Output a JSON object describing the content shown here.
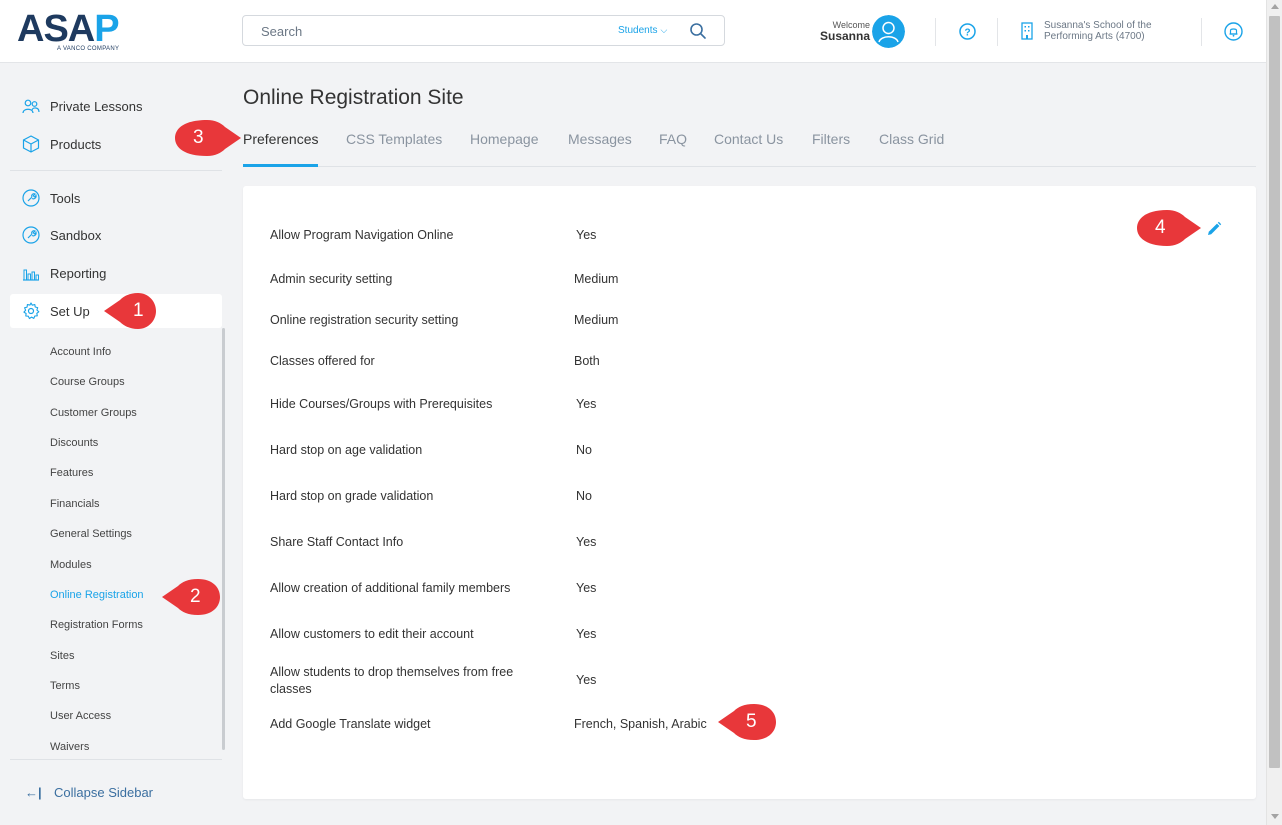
{
  "header": {
    "logo_text_main": "ASA",
    "logo_text_accent": "P",
    "logo_tagline": "A VANCO COMPANY",
    "search_placeholder": "Search",
    "search_scope": "Students",
    "welcome_label": "Welcome",
    "user_name": "Susanna",
    "school_name": "Susanna's School of the Performing Arts (4700)"
  },
  "sidebar": {
    "main_items": [
      {
        "label": "Private Lessons",
        "icon": "people-icon"
      },
      {
        "label": "Products",
        "icon": "box-icon"
      },
      {
        "label": "Tools",
        "icon": "wrench-icon"
      },
      {
        "label": "Sandbox",
        "icon": "wrench-icon"
      },
      {
        "label": "Reporting",
        "icon": "bar-chart-icon"
      },
      {
        "label": "Set Up",
        "icon": "gear-icon"
      }
    ],
    "active_item": "Set Up",
    "sub_items": [
      "Account Info",
      "Course Groups",
      "Customer Groups",
      "Discounts",
      "Features",
      "Financials",
      "General Settings",
      "Modules",
      "Online Registration",
      "Registration Forms",
      "Sites",
      "Terms",
      "User Access",
      "Waivers"
    ],
    "active_sub_item": "Online Registration",
    "collapse_label": "Collapse Sidebar"
  },
  "main": {
    "title": "Online Registration Site",
    "tabs": [
      "Preferences",
      "CSS Templates",
      "Homepage",
      "Messages",
      "FAQ",
      "Contact Us",
      "Filters",
      "Class Grid"
    ],
    "active_tab": "Preferences",
    "preferences": [
      {
        "label": "Allow Program Navigation Online",
        "value": "Yes"
      },
      {
        "label": "Admin security setting",
        "value": "Medium"
      },
      {
        "label": "Online registration security setting",
        "value": "Medium"
      },
      {
        "label": "Classes offered for",
        "value": "Both"
      },
      {
        "label": "Hide Courses/Groups with Prerequisites",
        "value": "Yes"
      },
      {
        "label": "Hard stop on age validation",
        "value": "No"
      },
      {
        "label": "Hard stop on grade validation",
        "value": "No"
      },
      {
        "label": "Share Staff Contact Info",
        "value": "Yes"
      },
      {
        "label": "Allow creation of additional family members",
        "value": "Yes"
      },
      {
        "label": "Allow customers to edit their account",
        "value": "Yes"
      },
      {
        "label": "Allow students to drop themselves from free classes",
        "value": "Yes"
      },
      {
        "label": "Add Google Translate widget",
        "value": "French, Spanish, Arabic"
      }
    ]
  },
  "callouts": [
    "1",
    "2",
    "3",
    "4",
    "5"
  ],
  "colors": {
    "accent": "#1aa3e8",
    "brand_dark": "#1e3a5f",
    "callout_red": "#e8373a"
  }
}
